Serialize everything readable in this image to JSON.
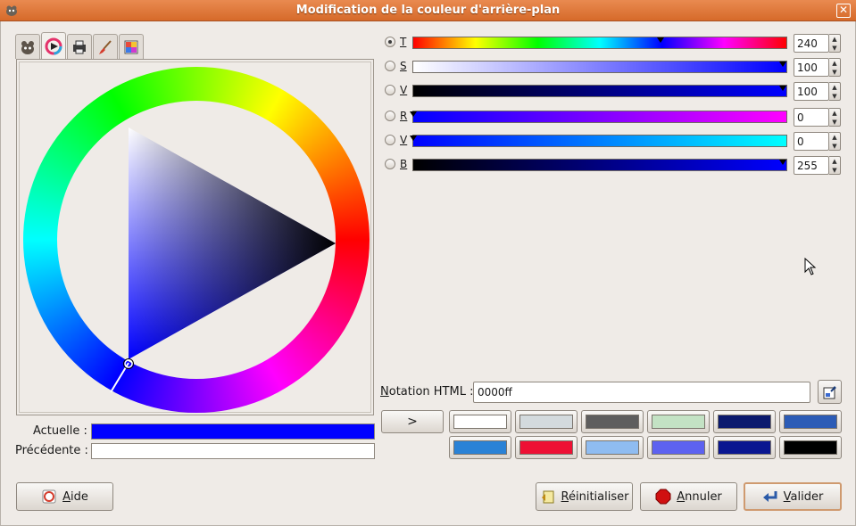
{
  "window": {
    "title": "Modification de la couleur d'arrière-plan"
  },
  "tabs": [
    {
      "icon": "gimp-icon"
    },
    {
      "icon": "color-wheel-icon"
    },
    {
      "icon": "printer-icon"
    },
    {
      "icon": "paintbrush-icon"
    },
    {
      "icon": "palette-icon"
    }
  ],
  "preview": {
    "current_label": "Actuelle :",
    "previous_label": "Précédente :",
    "current_color": "#0000ff",
    "previous_color": "#ffffff"
  },
  "channels": [
    {
      "label": "T",
      "value": "240",
      "checked": true
    },
    {
      "label": "S",
      "value": "100",
      "checked": false
    },
    {
      "label": "V",
      "value": "100",
      "checked": false
    },
    {
      "label": "R",
      "value": "0",
      "checked": false
    },
    {
      "label": "V",
      "value": "0",
      "checked": false
    },
    {
      "label": "B",
      "value": "255",
      "checked": false
    }
  ],
  "html": {
    "label_prefix": "N",
    "label_rest": "otation HTML :",
    "value": "0000ff"
  },
  "history": {
    "arrow_label": ">",
    "colors": [
      "#ffffff",
      "#d3dadd",
      "#5e5e5e",
      "#c3e2c4",
      "#0b1a6e",
      "#2c5cb6",
      "#2a82d6",
      "#ee1034",
      "#8fbcf1",
      "#5d62f0",
      "#0a1690",
      "#000000"
    ]
  },
  "buttons": {
    "help_u": "A",
    "help_rest": "ide",
    "reset_u": "R",
    "reset_rest": "éinitialiser",
    "cancel_u": "A",
    "cancel_rest": "nnuler",
    "ok_u": "V",
    "ok_rest": "alider"
  }
}
